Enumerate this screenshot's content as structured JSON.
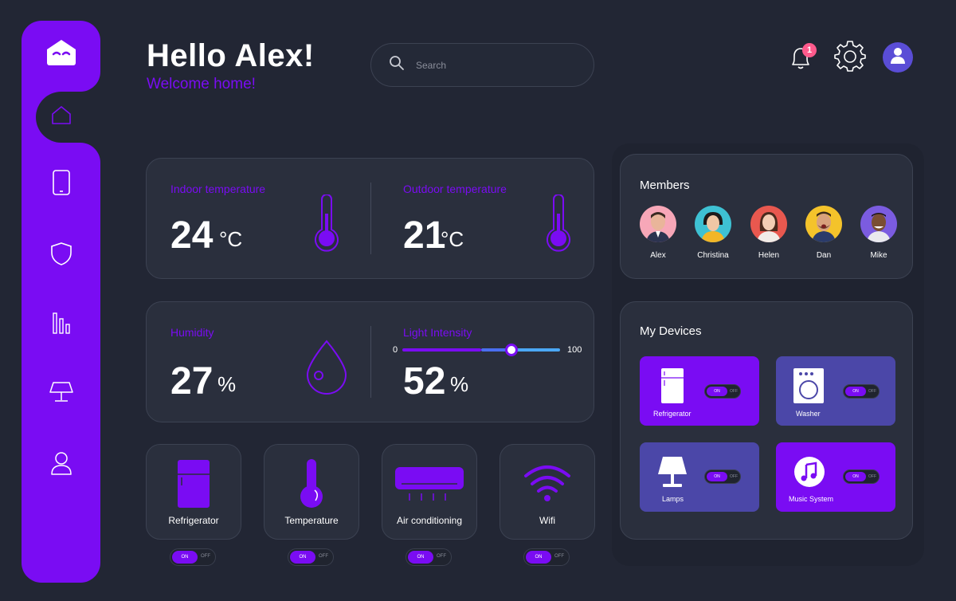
{
  "header": {
    "greeting": "Hello Alex!",
    "subgreeting": "Welcome home!",
    "search_placeholder": "Search",
    "notification_count": "1"
  },
  "sidebar": {
    "items": [
      {
        "name": "home",
        "icon": "house-icon"
      },
      {
        "name": "devices",
        "icon": "phone-icon"
      },
      {
        "name": "security",
        "icon": "shield-icon"
      },
      {
        "name": "statistics",
        "icon": "bar-chart-icon"
      },
      {
        "name": "lighting",
        "icon": "lamp-icon"
      },
      {
        "name": "profile",
        "icon": "user-icon"
      }
    ]
  },
  "temperature": {
    "indoor_label": "Indoor temperature",
    "indoor_value": "24",
    "indoor_unit": "°C",
    "outdoor_label": "Outdoor temperature",
    "outdoor_value": "21",
    "outdoor_unit": "°C"
  },
  "humidity": {
    "label": "Humidity",
    "value": "27",
    "unit": "%"
  },
  "light": {
    "label": "Light Intensity",
    "value": "52",
    "unit": "%",
    "min": "0",
    "max": "100",
    "slider_level": 0.69
  },
  "quick_devices": [
    {
      "label": "Refrigerator",
      "on": "ON",
      "off": "OFF"
    },
    {
      "label": "Temperature",
      "on": "ON",
      "off": "OFF"
    },
    {
      "label": "Air conditioning",
      "on": "ON",
      "off": "OFF"
    },
    {
      "label": "Wifi",
      "on": "ON",
      "off": "OFF"
    }
  ],
  "members": {
    "title": "Members",
    "list": [
      {
        "name": "Alex"
      },
      {
        "name": "Christina"
      },
      {
        "name": "Helen"
      },
      {
        "name": "Dan"
      },
      {
        "name": "Mike"
      }
    ]
  },
  "my_devices": {
    "title": "My Devices",
    "list": [
      {
        "label": "Refrigerator",
        "on": "ON",
        "off": "OFF"
      },
      {
        "label": "Washer",
        "on": "ON",
        "off": "OFF"
      },
      {
        "label": "Lamps",
        "on": "ON",
        "off": "OFF"
      },
      {
        "label": "Music System",
        "on": "ON",
        "off": "OFF"
      }
    ]
  },
  "colors": {
    "background": "#222634",
    "accent": "#7a0cf3",
    "card": "#2a2f3d",
    "device_inactive": "#4b47a8",
    "badge": "#ff5a8c",
    "slider_blue": "#4ba8f5"
  }
}
